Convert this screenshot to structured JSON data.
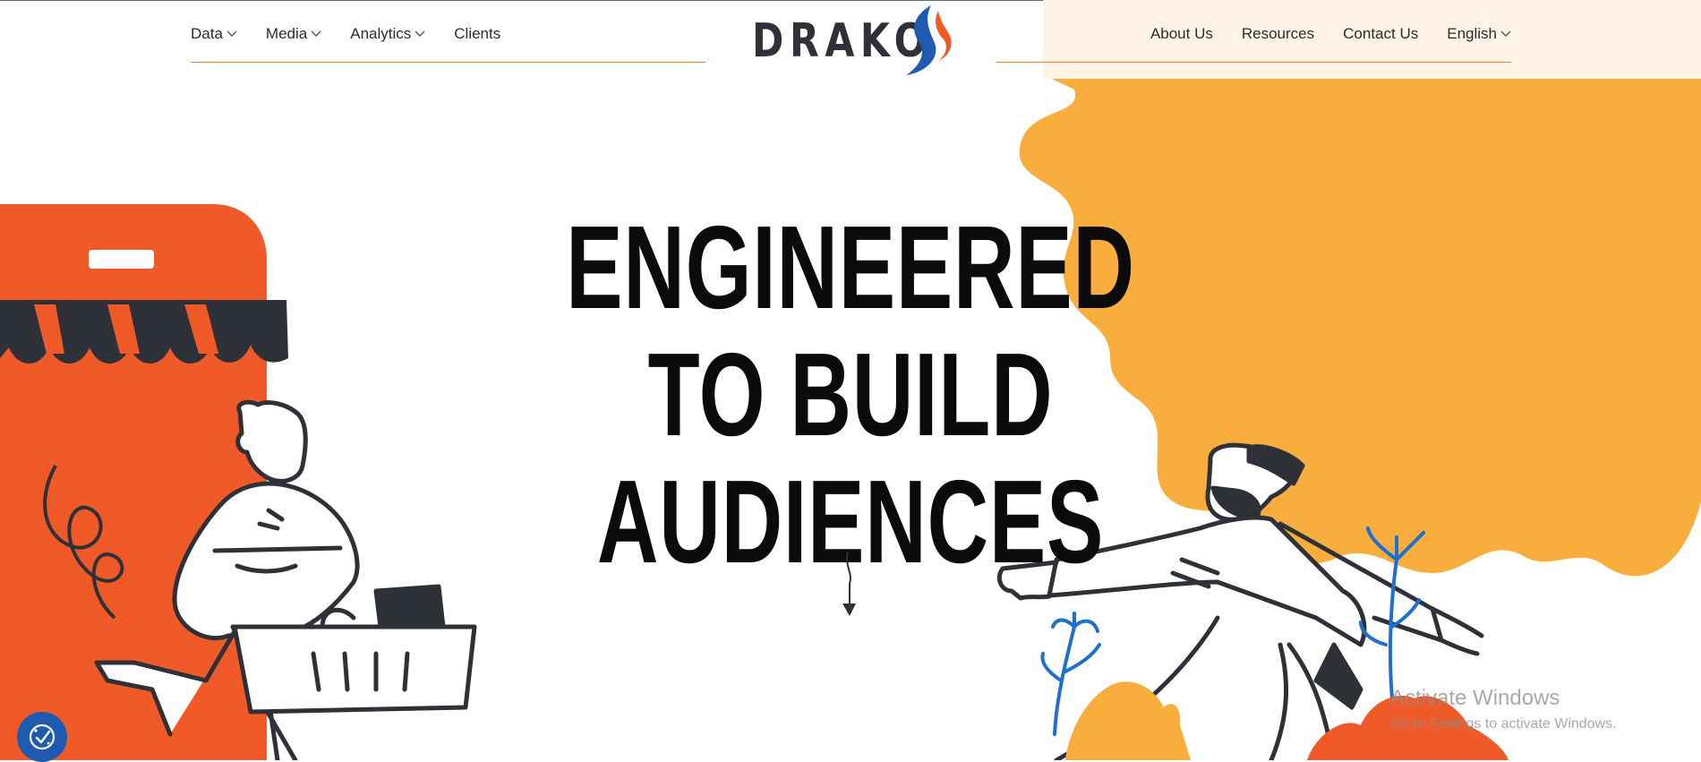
{
  "header": {
    "logo_text": "DRAKO",
    "nav_left": [
      {
        "label": "Data",
        "has_dropdown": true
      },
      {
        "label": "Media",
        "has_dropdown": true
      },
      {
        "label": "Analytics",
        "has_dropdown": true
      },
      {
        "label": "Clients",
        "has_dropdown": false
      }
    ],
    "nav_right": [
      {
        "label": "About Us",
        "has_dropdown": false
      },
      {
        "label": "Resources",
        "has_dropdown": false
      },
      {
        "label": "Contact Us",
        "has_dropdown": false
      },
      {
        "label": "English",
        "has_dropdown": true
      }
    ]
  },
  "hero": {
    "line1": "ENGINEERED TO BUILD",
    "line2": "AUDIENCES"
  },
  "icons": {
    "scroll": "arrow-down-icon",
    "cookie": "cookie-consent-icon",
    "chevron": "chevron-down-icon"
  },
  "colors": {
    "accent_orange": "#f05a28",
    "accent_yellow": "#f9ad3c",
    "brand_dark": "#2e3138",
    "brand_blue": "#1e5bb0"
  },
  "os_watermark": {
    "title": "Activate Windows",
    "subtitle": "Go to Settings to activate Windows."
  }
}
